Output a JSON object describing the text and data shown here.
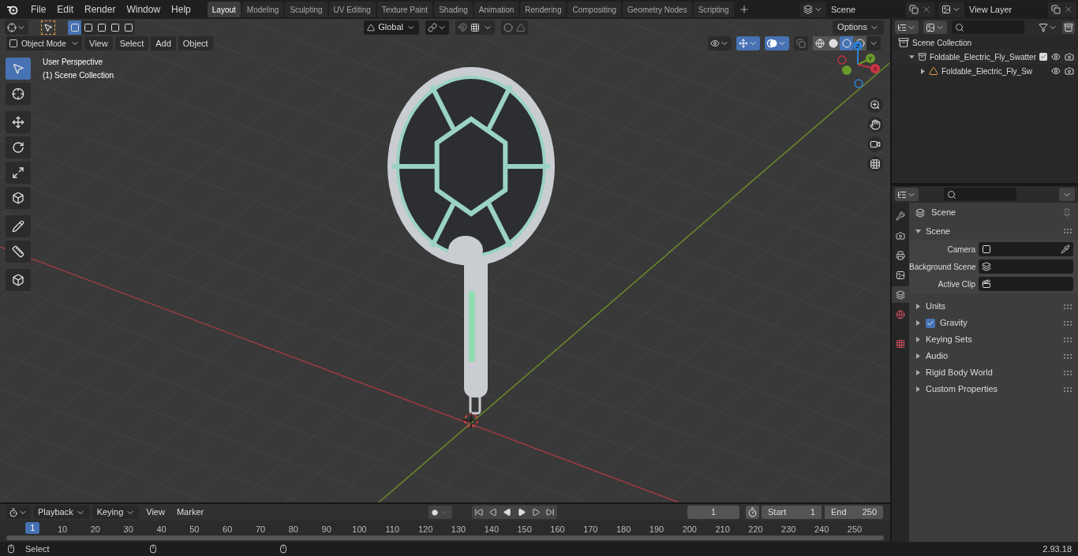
{
  "menu": [
    {
      "label": "File"
    },
    {
      "label": "Edit"
    },
    {
      "label": "Render"
    },
    {
      "label": "Window"
    },
    {
      "label": "Help"
    }
  ],
  "workspaces": [
    {
      "label": "Layout",
      "selected": true
    },
    {
      "label": "Modeling",
      "selected": false
    },
    {
      "label": "Sculpting",
      "selected": false
    },
    {
      "label": "UV Editing",
      "selected": false
    },
    {
      "label": "Texture Paint",
      "selected": false
    },
    {
      "label": "Shading",
      "selected": false
    },
    {
      "label": "Animation",
      "selected": false
    },
    {
      "label": "Rendering",
      "selected": false
    },
    {
      "label": "Compositing",
      "selected": false
    },
    {
      "label": "Geometry Nodes",
      "selected": false
    },
    {
      "label": "Scripting",
      "selected": false
    }
  ],
  "scene_field": {
    "value": "Scene"
  },
  "view_layer_field": {
    "value": "View Layer"
  },
  "viewport": {
    "select_modes": [
      {
        "selected": true
      },
      {
        "selected": false
      },
      {
        "selected": false
      },
      {
        "selected": false
      },
      {
        "selected": false
      }
    ],
    "transform_orientation": "Global",
    "options": "Options",
    "mode": "Object Mode",
    "menus": [
      "View",
      "Select",
      "Add",
      "Object"
    ],
    "gizmo_toggle": true,
    "overlay_toggle": true,
    "shading": [
      {
        "kind": "wireframe",
        "selected": false
      },
      {
        "kind": "solid",
        "selected": false
      },
      {
        "kind": "material",
        "selected": true
      },
      {
        "kind": "rendered",
        "selected": false
      }
    ],
    "overlay_text": [
      "User Perspective",
      "(1) Scene Collection"
    ],
    "tools": [
      {
        "kind": "select",
        "selected": true
      },
      {
        "kind": "cursor",
        "selected": false
      },
      {
        "kind": "move",
        "selected": false
      },
      {
        "kind": "rotate",
        "selected": false
      },
      {
        "kind": "scale",
        "selected": false
      },
      {
        "kind": "transform",
        "selected": false
      },
      {
        "kind": "annotate",
        "selected": false
      },
      {
        "kind": "measure",
        "selected": false
      },
      {
        "kind": "add_cube",
        "selected": false
      }
    ],
    "gizmo_axes": [
      "Z",
      "Y",
      "X"
    ]
  },
  "outliner": {
    "label": "Scene Collection",
    "children": [
      {
        "label": "Foldable_Electric_Fly_Swatter",
        "expanded": true,
        "checked": true,
        "children": [
          {
            "label": "Foldable_Electric_Fly_Sw",
            "expanded": false
          }
        ]
      }
    ]
  },
  "properties": {
    "tabs": [
      {
        "kind": "tool",
        "selected": false
      },
      {
        "kind": "render",
        "selected": false
      },
      {
        "kind": "output",
        "selected": false
      },
      {
        "kind": "view_layer",
        "selected": false
      },
      {
        "kind": "scene",
        "selected": true
      },
      {
        "kind": "world",
        "selected": false
      },
      {
        "kind": "texture",
        "selected": false
      }
    ],
    "header": "Scene",
    "panel": {
      "label": "Scene",
      "expanded": true,
      "fields": [
        {
          "label": "Camera",
          "kind": "camera"
        },
        {
          "label": "Background Scene",
          "kind": "scene"
        },
        {
          "label": "Active Clip",
          "kind": "clip"
        }
      ]
    },
    "sections": [
      {
        "label": "Units",
        "expanded": false
      },
      {
        "label": "Gravity",
        "expanded": false,
        "checked": true
      },
      {
        "label": "Keying Sets",
        "expanded": false
      },
      {
        "label": "Audio",
        "expanded": false
      },
      {
        "label": "Rigid Body World",
        "expanded": false
      },
      {
        "label": "Custom Properties",
        "expanded": false
      }
    ]
  },
  "timeline": {
    "menus": [
      {
        "label": "Playback",
        "kind": "dropdown"
      },
      {
        "label": "Keying",
        "kind": "dropdown"
      },
      {
        "label": "View",
        "kind": "menu"
      },
      {
        "label": "Marker",
        "kind": "menu"
      }
    ],
    "current_frame": "1",
    "start_label": "Start",
    "start": "1",
    "end_label": "End",
    "end": "250",
    "playhead": "1",
    "ruler": [
      "10",
      "20",
      "30",
      "40",
      "50",
      "60",
      "70",
      "80",
      "90",
      "100",
      "110",
      "120",
      "130",
      "140",
      "150",
      "160",
      "170",
      "180",
      "190",
      "200",
      "210",
      "220",
      "230",
      "240",
      "250"
    ]
  },
  "status_bar": {
    "action": "Select",
    "version": "2.93.18"
  }
}
